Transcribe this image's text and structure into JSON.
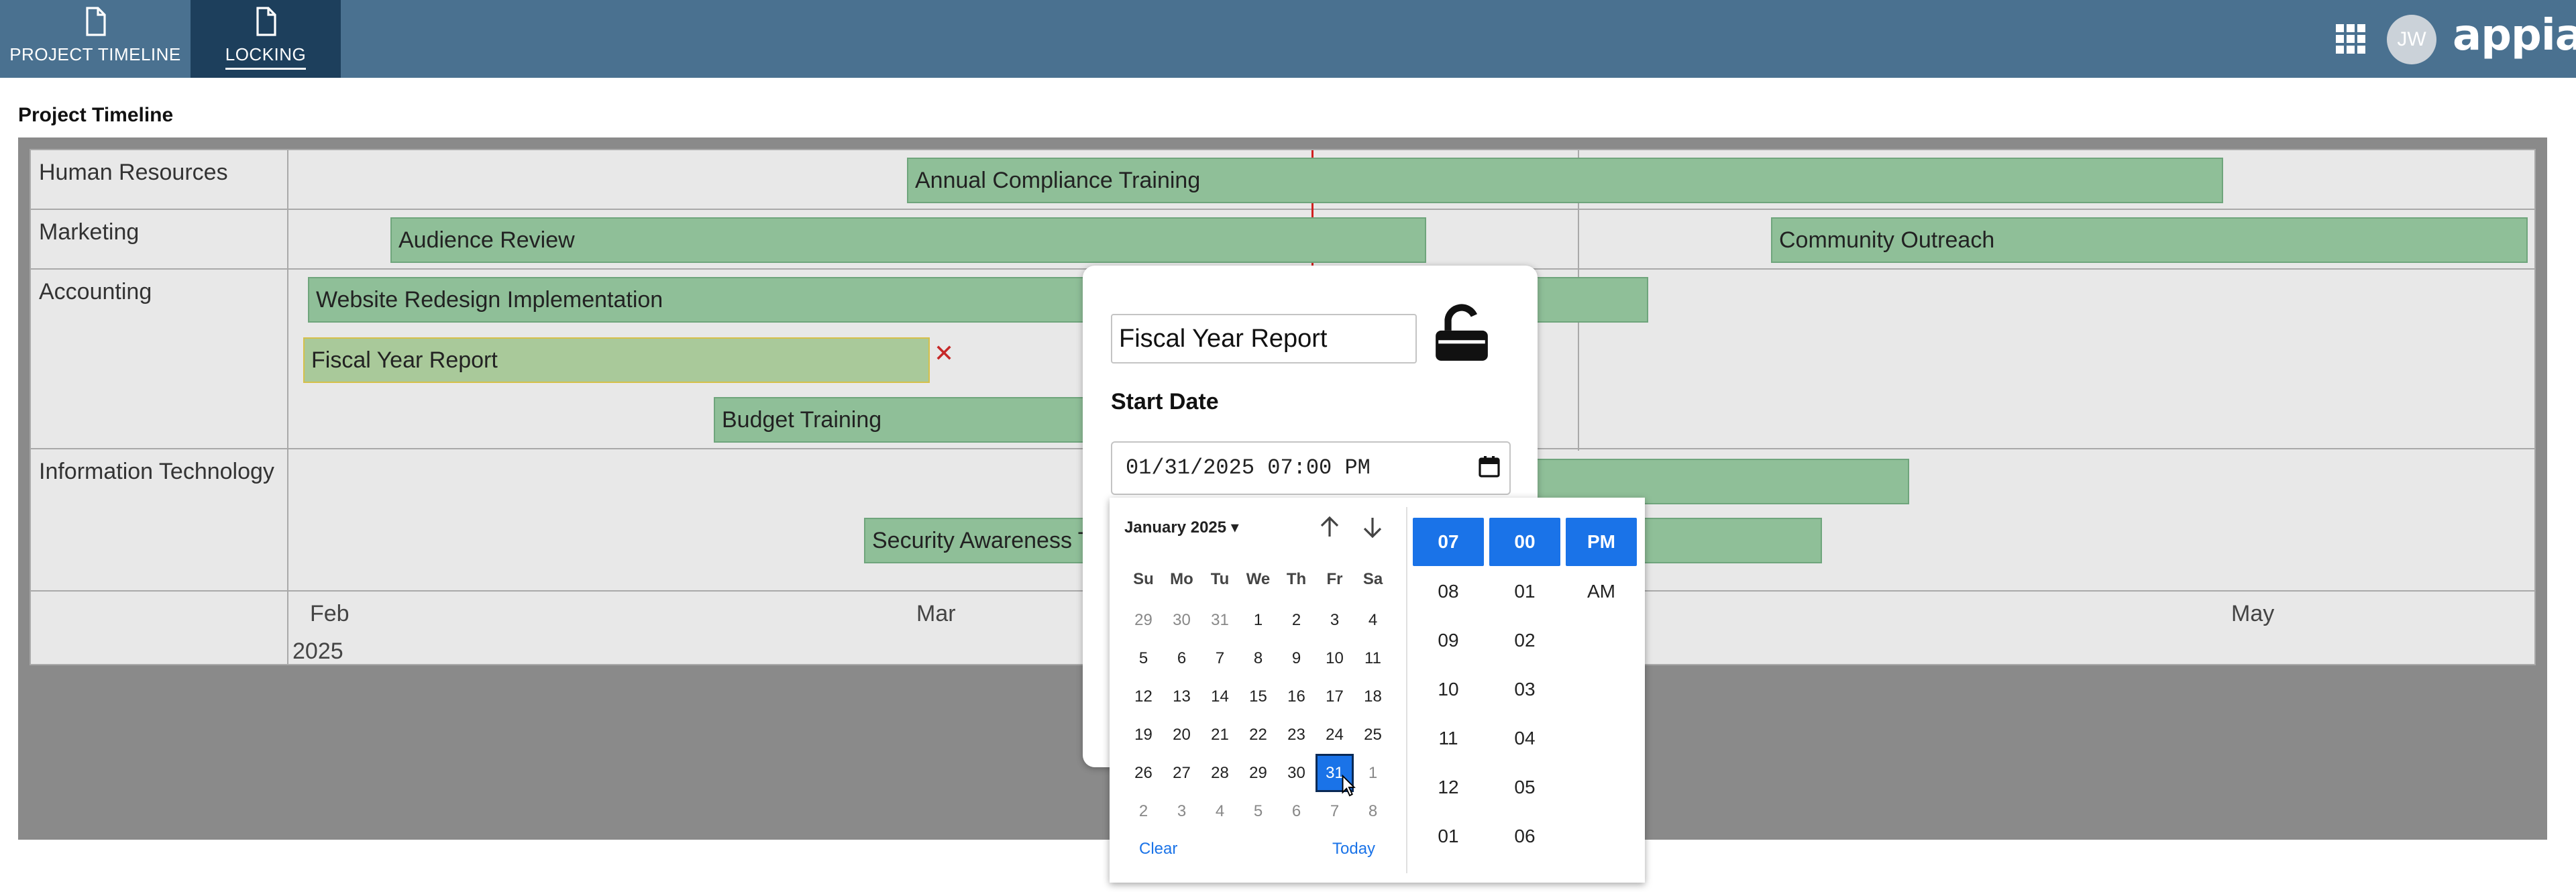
{
  "nav": {
    "tabs": [
      {
        "label": "PROJECT TIMELINE",
        "icon": "document-icon"
      },
      {
        "label": "LOCKING",
        "icon": "document-icon",
        "active": true
      }
    ],
    "apps_icon": "grid-icon",
    "user_initials": "JW",
    "brand": "appian"
  },
  "page_title": "Project Timeline",
  "timeline": {
    "rows": [
      "Human Resources",
      "Marketing",
      "Accounting",
      "Information Technology"
    ],
    "bars": {
      "annual_compliance": "Annual Compliance Training",
      "audience_review": "Audience Review",
      "community_outreach": "Community Outreach",
      "website_redesign": "Website Redesign Implementation",
      "fiscal_year_report": "Fiscal Year Report",
      "budget_training": "Budget Training",
      "security_awareness": "Security Awareness Training"
    },
    "axis": {
      "feb": "Feb",
      "mar": "Mar",
      "may": "May",
      "year": "2025"
    },
    "remove_symbol": "✕"
  },
  "dialog": {
    "title_value": "Fiscal Year Report",
    "lock_state": "unlocked",
    "start_date_label": "Start Date",
    "start_date_value": "01/31/2025 07:00 PM"
  },
  "picker": {
    "month_label": "January 2025",
    "weekdays": [
      "Su",
      "Mo",
      "Tu",
      "We",
      "Th",
      "Fr",
      "Sa"
    ],
    "weeks": [
      [
        "29",
        "30",
        "31",
        "1",
        "2",
        "3",
        "4"
      ],
      [
        "5",
        "6",
        "7",
        "8",
        "9",
        "10",
        "11"
      ],
      [
        "12",
        "13",
        "14",
        "15",
        "16",
        "17",
        "18"
      ],
      [
        "19",
        "20",
        "21",
        "22",
        "23",
        "24",
        "25"
      ],
      [
        "26",
        "27",
        "28",
        "29",
        "30",
        "31",
        "1"
      ],
      [
        "2",
        "3",
        "4",
        "5",
        "6",
        "7",
        "8"
      ]
    ],
    "selected_day": "31",
    "clear_label": "Clear",
    "today_label": "Today",
    "hours": [
      "07",
      "08",
      "09",
      "10",
      "11",
      "12",
      "01"
    ],
    "minutes": [
      "00",
      "01",
      "02",
      "03",
      "04",
      "05",
      "06"
    ],
    "periods": [
      "PM",
      "AM"
    ],
    "selected_hour": "07",
    "selected_minute": "00",
    "selected_period": "PM"
  },
  "colors": {
    "topbar": "#4a7190",
    "active_tab": "#1d3f5c",
    "bar_fill": "#8fbf98",
    "selection_blue": "#1a73e8",
    "today_line": "#d02020"
  }
}
